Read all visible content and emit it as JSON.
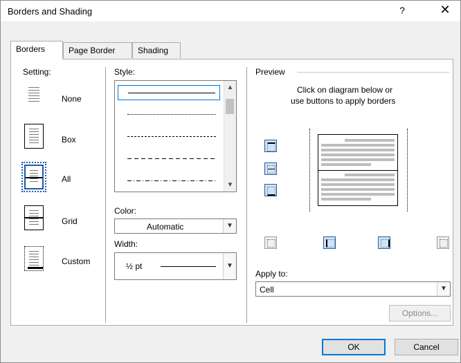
{
  "window": {
    "title": "Borders and Shading",
    "help": "?",
    "close": "✕"
  },
  "tabs": [
    "Borders",
    "Page Border",
    "Shading"
  ],
  "setting": {
    "label": "Setting:",
    "items": [
      "None",
      "Box",
      "All",
      "Grid",
      "Custom"
    ],
    "selected": "All"
  },
  "style": {
    "label": "Style:",
    "lines": [
      "solid",
      "dotted",
      "dashed",
      "dashed-wide",
      "dash-dot"
    ],
    "selected": "solid"
  },
  "color": {
    "label": "Color:",
    "value": "Automatic"
  },
  "width": {
    "label": "Width:",
    "value": "½ pt"
  },
  "preview": {
    "label": "Preview",
    "hint_line1": "Click on diagram below or",
    "hint_line2": "use buttons to apply borders"
  },
  "apply_to": {
    "label": "Apply to:",
    "value": "Cell"
  },
  "buttons": {
    "options": "Options...",
    "ok": "OK",
    "cancel": "Cancel"
  },
  "colors": {
    "accent": "#0078d7",
    "selected_icon": "#1e5ba8"
  }
}
